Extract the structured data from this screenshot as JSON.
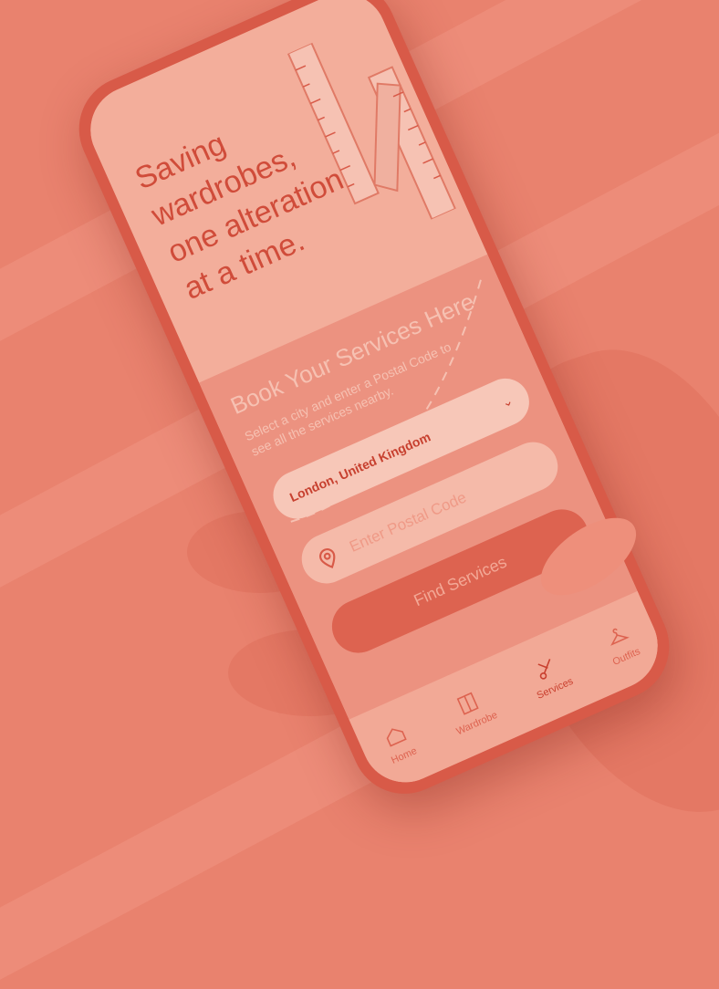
{
  "hero": {
    "title": "Saving wardrobes, one alteration at a time."
  },
  "booking": {
    "title": "Book Your Services Here",
    "subtitle": "Select a city and enter a Postal Code to see all the services nearby.",
    "city": {
      "selected": "London, United Kingdom"
    },
    "postal": {
      "placeholder": "Enter Postal Code",
      "value": ""
    },
    "find_button": "Find Services"
  },
  "tabbar": {
    "items": [
      {
        "label": "Home",
        "icon": "home-icon",
        "active": false
      },
      {
        "label": "Wardrobe",
        "icon": "wardrobe-icon",
        "active": false
      },
      {
        "label": "Services",
        "icon": "scissors-icon",
        "active": true
      },
      {
        "label": "Outfits",
        "icon": "hanger-icon",
        "active": false
      }
    ]
  },
  "colors": {
    "accent": "#d04c3a",
    "background": "#e9826e",
    "hero_bg": "#f3ae9b",
    "booking_bg": "#ec9280"
  }
}
